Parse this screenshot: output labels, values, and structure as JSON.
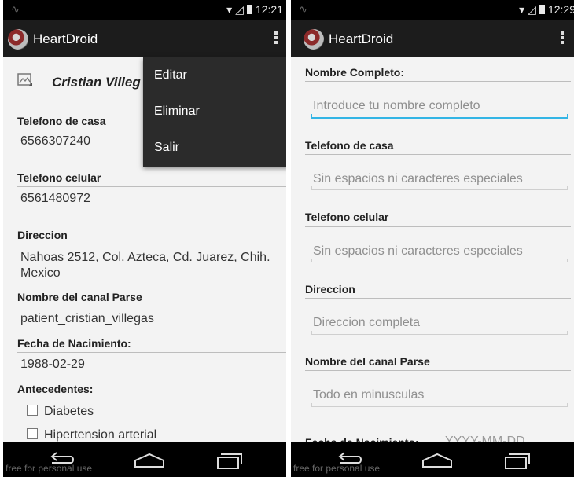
{
  "status_bar": {
    "left": {
      "time": "12:21"
    },
    "right": {
      "time": "12:29"
    }
  },
  "app": {
    "title": "HeartDroid"
  },
  "detail": {
    "name": "Cristian Villeg",
    "home_phone_label": "Telefono de casa",
    "home_phone": "6566307240",
    "cell_phone_label": "Telefono celular",
    "cell_phone": "6561480972",
    "address_label": "Direccion",
    "address": "Nahoas 2512, Col. Azteca, Cd. Juarez, Chih. Mexico",
    "channel_label": "Nombre del canal Parse",
    "channel": "patient_cristian_villegas",
    "dob_label": "Fecha de Nacimiento:",
    "dob": "1988-02-29",
    "history_label": "Antecedentes:",
    "history": [
      {
        "label": "Diabetes",
        "checked": false
      },
      {
        "label": "Hipertension arterial",
        "checked": false
      }
    ]
  },
  "overflow_menu": {
    "items": [
      "Editar",
      "Eliminar",
      "Salir"
    ]
  },
  "form": {
    "full_name_label": "Nombre Completo:",
    "full_name_placeholder": "Introduce tu nombre completo",
    "home_phone_label": "Telefono de casa",
    "home_phone_placeholder": "Sin espacios ni caracteres especiales",
    "cell_phone_label": "Telefono celular",
    "cell_phone_placeholder": "Sin espacios ni caracteres especiales",
    "address_label": "Direccion",
    "address_placeholder": "Direccion completa",
    "channel_label": "Nombre del canal Parse",
    "channel_placeholder": "Todo en minusculas",
    "dob_label": "Fecha de Nacimiento:",
    "dob_placeholder": "YYYY-MM-DD"
  },
  "watermark": "free for personal use",
  "icons": [
    "activity-icon",
    "wifi-icon",
    "signal-icon",
    "battery-icon",
    "app-logo-icon",
    "overflow-menu-icon",
    "contact-card-icon",
    "phone-icon",
    "back-icon",
    "home-icon",
    "recent-apps-icon"
  ],
  "colors": {
    "action_bar": "#1c1c1c",
    "menu_bg": "#2b2b2b",
    "focus_accent": "#33b5e5",
    "background": "#f3f3f3"
  }
}
